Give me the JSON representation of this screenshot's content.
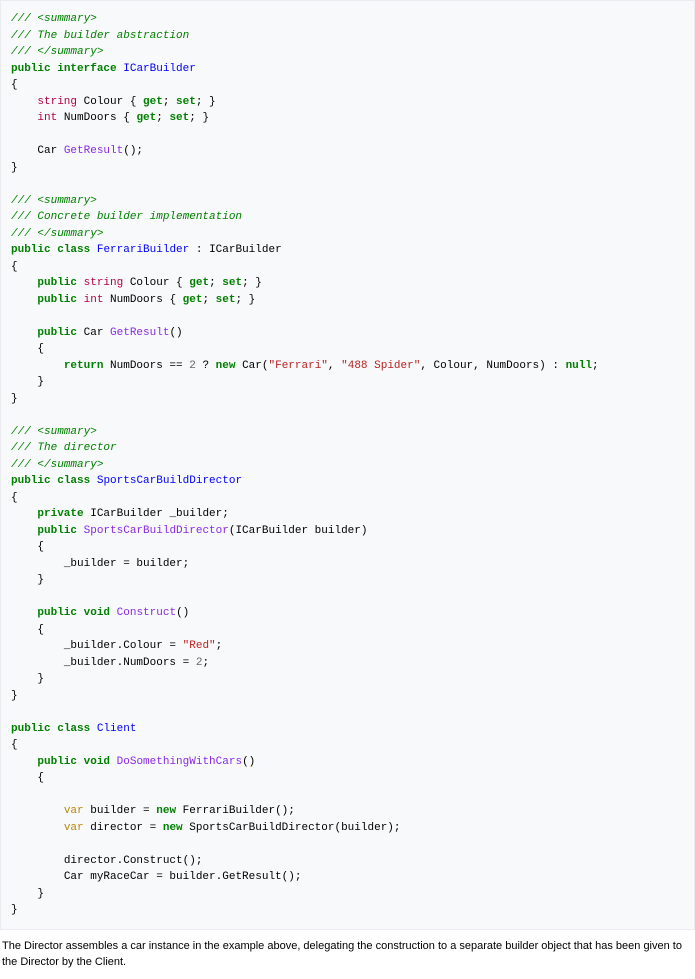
{
  "code": {
    "c1": "/// <summary>",
    "c2": "/// The builder abstraction",
    "c3": "/// </summary>",
    "l4_kw1": "public",
    "l4_kw2": "interface",
    "l4_nm": "ICarBuilder",
    "l5": "{",
    "l6_ty": "string",
    "l6_txt1": " Colour { ",
    "l6_get": "get",
    "l6_txt2": "; ",
    "l6_set": "set",
    "l6_txt3": "; }",
    "l7_ty": "int",
    "l7_txt1": " NumDoors { ",
    "l7_get": "get",
    "l7_txt2": "; ",
    "l7_set": "set",
    "l7_txt3": "; }",
    "l8_txt1": "Car ",
    "l8_mth": "GetResult",
    "l8_txt2": "();",
    "l9": "}",
    "c10": "/// <summary>",
    "c11": "/// Concrete builder implementation",
    "c12": "/// </summary>",
    "l13_kw1": "public",
    "l13_kw2": "class",
    "l13_nm": "FerrariBuilder",
    "l13_txt": " : ICarBuilder",
    "l14": "{",
    "l15_kw": "public",
    "l15_ty": "string",
    "l15_txt1": " Colour { ",
    "l15_get": "get",
    "l15_txt2": "; ",
    "l15_set": "set",
    "l15_txt3": "; }",
    "l16_kw": "public",
    "l16_ty": "int",
    "l16_txt1": " NumDoors { ",
    "l16_get": "get",
    "l16_txt2": "; ",
    "l16_set": "set",
    "l16_txt3": "; }",
    "l17_kw": "public",
    "l17_txt1": " Car ",
    "l17_mth": "GetResult",
    "l17_txt2": "()",
    "l18": "{",
    "l19_kw1": "return",
    "l19_txt1": " NumDoors == ",
    "l19_num": "2",
    "l19_txt2": " ? ",
    "l19_kw2": "new",
    "l19_txt3": " Car(",
    "l19_s1": "\"Ferrari\"",
    "l19_txt4": ", ",
    "l19_s2": "\"488 Spider\"",
    "l19_txt5": ", Colour, NumDoors) : ",
    "l19_nul": "null",
    "l19_txt6": ";",
    "l20": "}",
    "l21": "}",
    "c22": "/// <summary>",
    "c23": "/// The director",
    "c24": "/// </summary>",
    "l25_kw1": "public",
    "l25_kw2": "class",
    "l25_nm": "SportsCarBuildDirector",
    "l26": "{",
    "l27_kw": "private",
    "l27_txt": " ICarBuilder _builder;",
    "l28_kw": "public",
    "l28_mth": "SportsCarBuildDirector",
    "l28_txt": "(ICarBuilder builder)",
    "l29": "{",
    "l30": "_builder = builder;",
    "l31": "}",
    "l32_kw1": "public",
    "l32_kw2": "void",
    "l32_mth": "Construct",
    "l32_txt": "()",
    "l33": "{",
    "l34_txt1": "_builder.Colour = ",
    "l34_s": "\"Red\"",
    "l34_txt2": ";",
    "l35_txt1": "_builder.NumDoors = ",
    "l35_num": "2",
    "l35_txt2": ";",
    "l36": "}",
    "l37": "}",
    "l38_kw1": "public",
    "l38_kw2": "class",
    "l38_nm": "Client",
    "l39": "{",
    "l40_kw1": "public",
    "l40_kw2": "void",
    "l40_mth": "DoSomethingWithCars",
    "l40_txt": "()",
    "l41": "{",
    "l42_var": "var",
    "l42_txt1": " builder = ",
    "l42_kw": "new",
    "l42_txt2": " FerrariBuilder();",
    "l43_var": "var",
    "l43_txt1": " director = ",
    "l43_kw": "new",
    "l43_txt2": " SportsCarBuildDirector(builder);",
    "l44": "director.Construct();",
    "l45": "Car myRaceCar = builder.GetResult();",
    "l46": "}",
    "l47": "}"
  },
  "caption": "The Director assembles a car instance in the example above, delegating the construction to a separate builder object that has been given to the Director by the Client."
}
